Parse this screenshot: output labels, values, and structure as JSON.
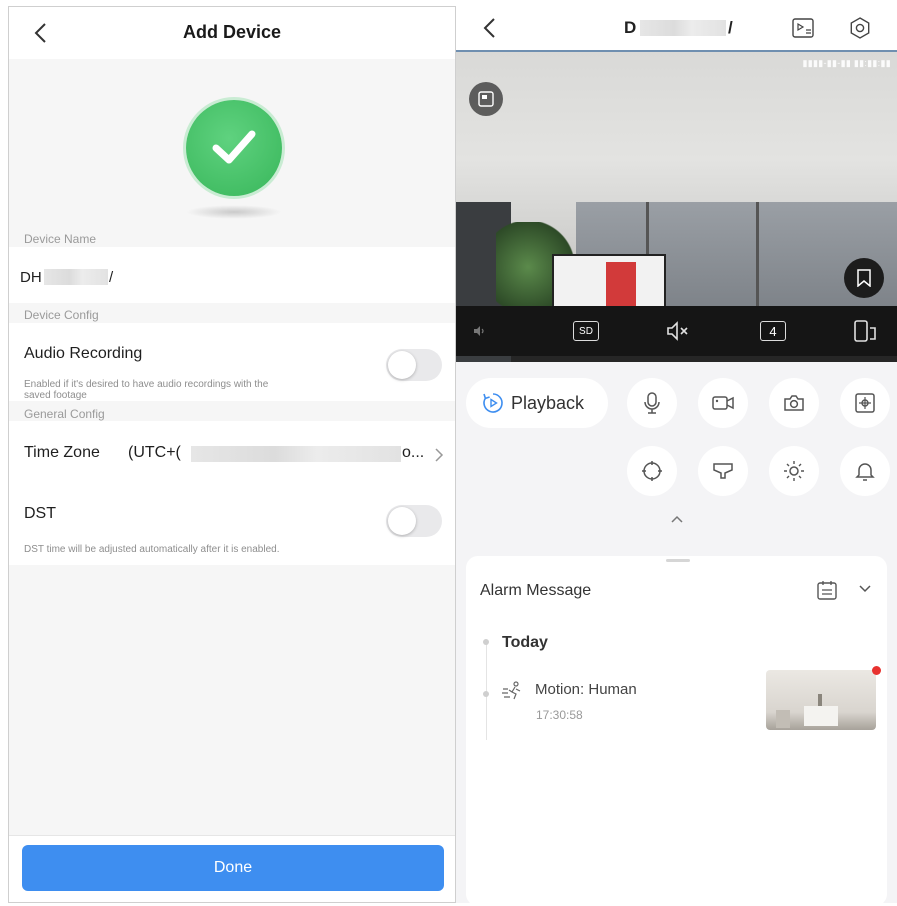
{
  "left": {
    "header": {
      "title": "Add Device"
    },
    "sections": {
      "device_name": "Device Name",
      "device_config": "Device Config",
      "general_config": "General Config"
    },
    "device_name_value": "DH",
    "device_name_suffix": "/",
    "audio_recording": {
      "label": "Audio Recording",
      "hint_line1": "Enabled if it's desired to have audio recordings with the",
      "hint_line2": "saved footage",
      "enabled": false
    },
    "time_zone": {
      "label": "Time Zone",
      "value_prefix": "(UTC+(",
      "value_suffix": "o..."
    },
    "dst": {
      "label": "DST",
      "hint": "DST time will be adjusted automatically after it is enabled.",
      "enabled": false
    },
    "done_label": "Done"
  },
  "right": {
    "header": {
      "title_prefix": "D",
      "title_suffix": "/"
    },
    "video": {
      "quality_label": "SD",
      "split_count": "4"
    },
    "controls": {
      "playback_label": "Playback"
    },
    "alarm": {
      "title": "Alarm Message",
      "day_label": "Today",
      "event_label": "Motion: Human",
      "event_time": "17:30:58"
    }
  },
  "colors": {
    "accent": "#3e8ef0",
    "success": "#3cba5e",
    "alert": "#e8322f"
  }
}
